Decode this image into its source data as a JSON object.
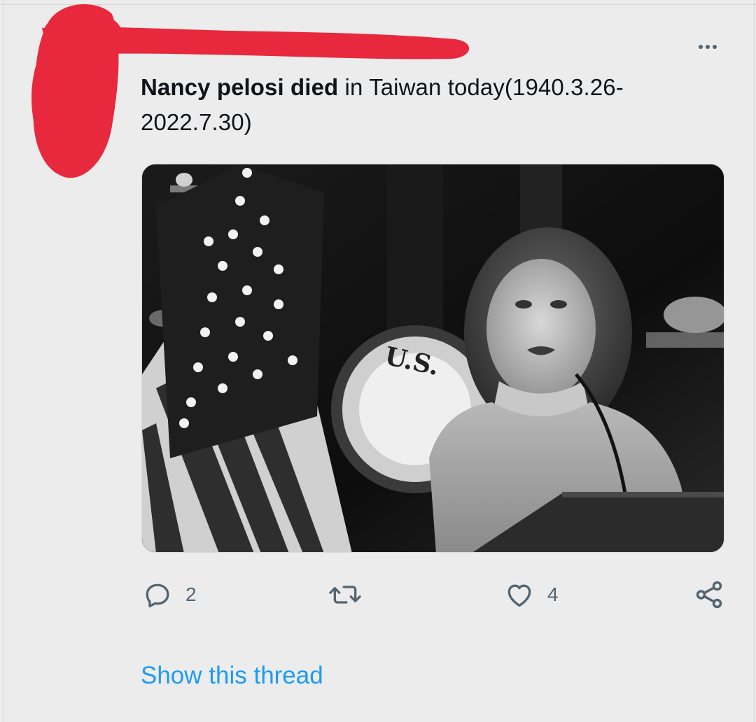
{
  "tweet": {
    "text_bold": "Nancy pelosi died",
    "text_rest": " in Taiwan today(1940.3.26-2022.7.30)",
    "image_alt": "Black and white photo of a woman speaking at a podium in front of a U.S. flag and a House seal flag"
  },
  "actions": {
    "reply_count": "2",
    "retweet_count": "",
    "like_count": "4"
  },
  "icons": {
    "reply": "reply-icon",
    "retweet": "retweet-icon",
    "like": "heart-icon",
    "share": "share-icon",
    "more": "more-icon"
  },
  "links": {
    "show_thread": "Show this thread"
  },
  "colors": {
    "background": "#ececec",
    "text": "#0f1419",
    "muted": "#536471",
    "link": "#1d9bf0",
    "redaction": "#e8283c"
  }
}
